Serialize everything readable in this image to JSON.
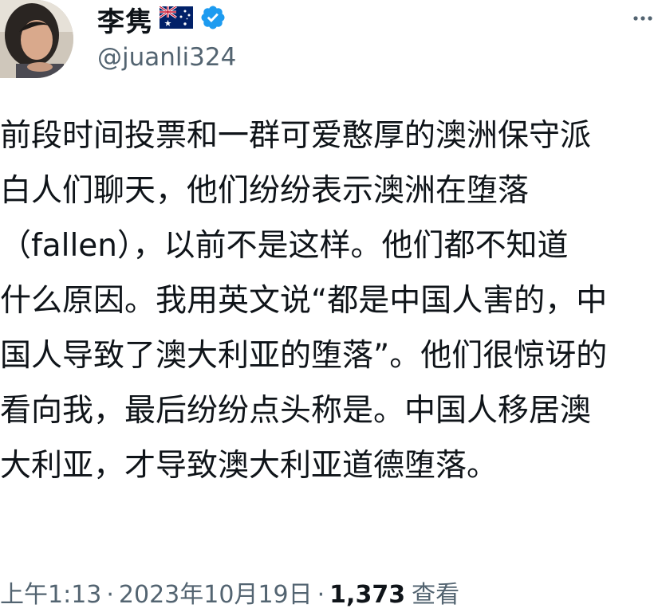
{
  "author": {
    "display_name": "李隽",
    "handle": "@juanli324",
    "avatar_icon": "profile-photo",
    "flag_icon": "australia-flag-icon",
    "verified_icon": "verified-badge-icon",
    "verified_color": "#1d9bf0"
  },
  "more_icon": "more-horizontal-icon",
  "tweet": {
    "lines": [
      "前段时间投票和一群可爱憨厚的澳洲保守派",
      "白人们聊天，他们纷纷表示澳洲在堕落",
      "（fallen），以前不是这样。他们都不知道",
      "什么原因。我用英文说“都是中国人害的，中",
      "国人导致了澳大利亚的堕落”。他们很惊讶的",
      "看向我，最后纷纷点头称是。中国人移居澳",
      "大利亚，才导致澳大利亚道德堕落。"
    ]
  },
  "meta": {
    "time": "上午1:13",
    "separator": "·",
    "date": "2023年10月19日",
    "views_count": "1,373",
    "views_label": "查看"
  },
  "colors": {
    "text": "#0f1419",
    "secondary": "#536471",
    "accent": "#1d9bf0"
  }
}
